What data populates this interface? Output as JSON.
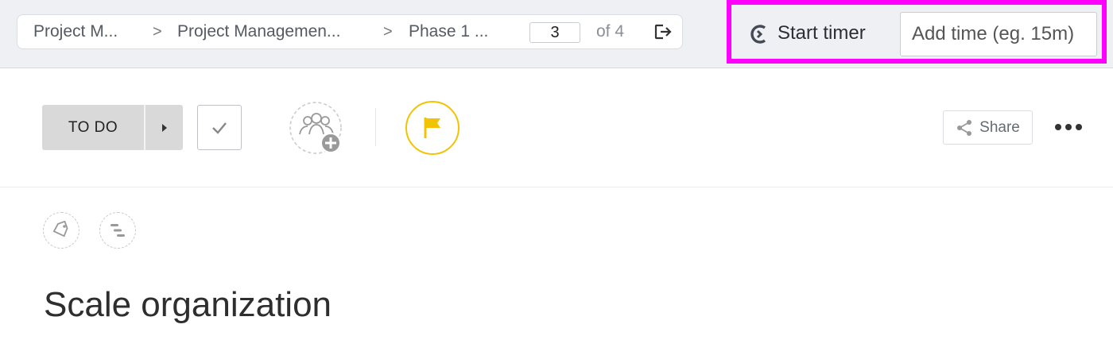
{
  "breadcrumb": {
    "items": [
      "Project M...",
      "Project Managemen...",
      "Phase 1 ..."
    ],
    "separator": ">"
  },
  "pager": {
    "current": "3",
    "of_label": "of 4"
  },
  "timer": {
    "start_label": "Start timer",
    "add_time_placeholder": "Add time (eg. 15m)"
  },
  "task": {
    "status": "TO DO",
    "title": "Scale organization",
    "share_label": "Share"
  },
  "icons": {
    "exit": "exit-icon",
    "timer": "timer-icon",
    "check": "check-icon",
    "assignee": "add-assignee-icon",
    "flag": "flag-icon",
    "share": "share-icon",
    "more": "more-icon",
    "tag": "tag-icon",
    "gantt": "dependency-icon"
  },
  "colors": {
    "highlight": "#ff00ff",
    "flag": "#f2c300",
    "status_bg": "#d9d9d9"
  }
}
